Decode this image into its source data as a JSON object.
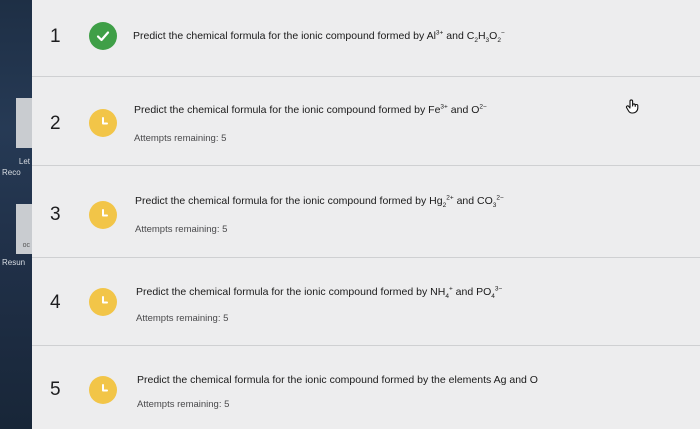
{
  "sidebar": {
    "labels": [
      "Let",
      "Reco",
      "oc",
      "Resun"
    ]
  },
  "questions": [
    {
      "number": "1",
      "status": "correct",
      "prompt": "Predict the chemical formula for the ionic compound formed by",
      "species": [
        "Al³⁺",
        "C₂H₃O₂⁻"
      ],
      "conj": "and",
      "attempts": ""
    },
    {
      "number": "2",
      "status": "pending",
      "prompt": "Predict the chemical formula for the ionic compound formed by",
      "species": [
        "Fe³⁺",
        "O²⁻"
      ],
      "conj": "and",
      "attempts": "Attempts remaining: 5"
    },
    {
      "number": "3",
      "status": "pending",
      "prompt": "Predict the chemical formula for the ionic compound formed by",
      "species": [
        "Hg₂²⁺",
        "CO₃²⁻"
      ],
      "conj": "and",
      "attempts": "Attempts remaining: 5"
    },
    {
      "number": "4",
      "status": "pending",
      "prompt": "Predict the chemical formula for the ionic compound formed by",
      "species": [
        "NH₄⁺",
        "PO₄³⁻"
      ],
      "conj": "and",
      "attempts": "Attempts remaining: 5"
    },
    {
      "number": "5",
      "status": "pending",
      "prompt": "Predict the chemical formula for the ionic compound formed by the elements Ag and O",
      "species": [],
      "conj": "",
      "attempts": "Attempts remaining: 5"
    }
  ],
  "colors": {
    "correct": "#3f9f47",
    "pending": "#f2c548"
  },
  "icons": {
    "correct": "check-icon",
    "pending": "clock-icon",
    "pointer": "hand-pointer-icon"
  }
}
